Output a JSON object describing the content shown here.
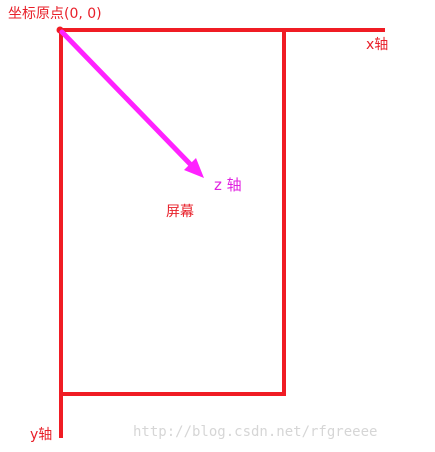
{
  "labels": {
    "origin": "坐标原点(0, 0)",
    "x_axis": "x轴",
    "y_axis": "y轴",
    "z_axis": "z 轴",
    "screen": "屏幕"
  },
  "watermark": "http://blog.csdn.net/rfgreeee",
  "colors": {
    "axes": "#f01c24",
    "screen_outline": "#f01c24",
    "z_arrow": "#ff22ff",
    "text_red": "#e8202a",
    "text_magenta": "#e020e0",
    "watermark": "#d6d6d6"
  }
}
